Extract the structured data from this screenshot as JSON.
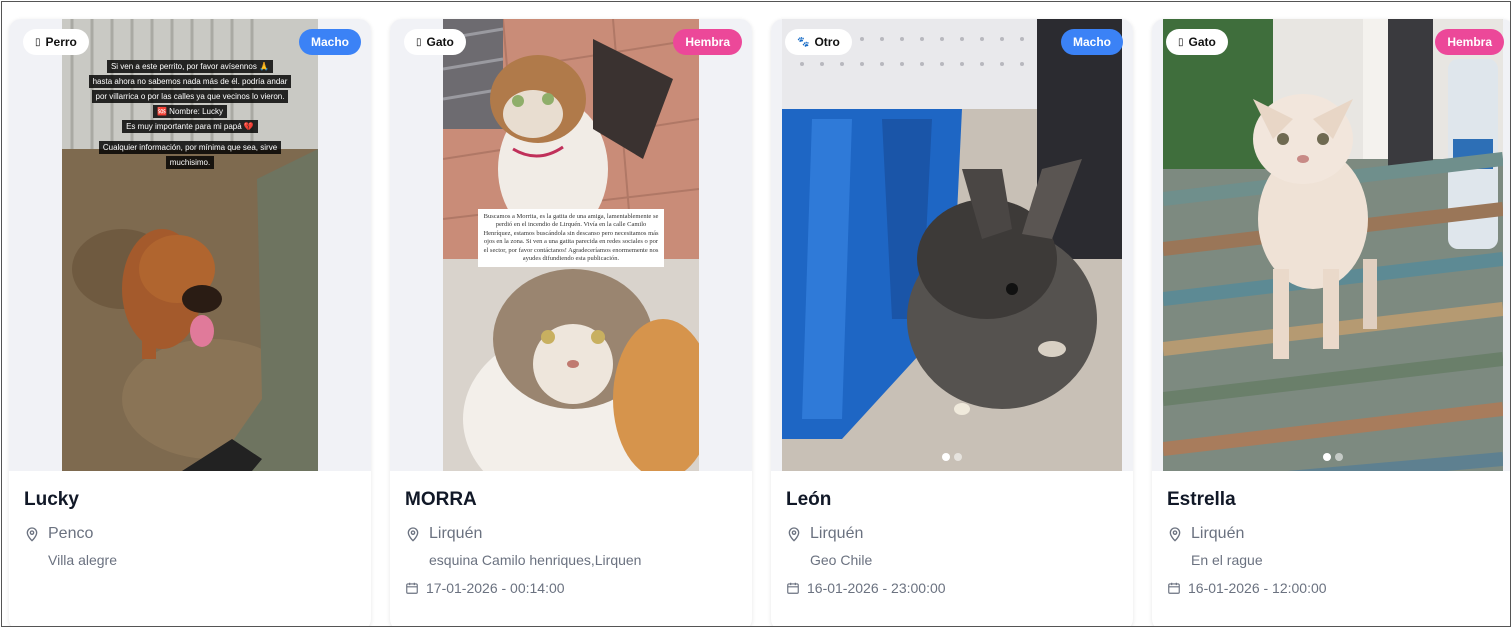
{
  "cards": [
    {
      "name": "Lucky",
      "type_icon": "phone-glyph",
      "type": "Perro",
      "sex": "Macho",
      "location": "Penco",
      "detail": "Villa alegre",
      "date": "",
      "image_text": [
        "Si ven a este perrito, por favor avísennos 🙏",
        "hasta ahora no sabemos nada más de él. podría andar",
        "por villarrica o por las calles ya que vecinos lo vieron.",
        "🆘 Nombre: Lucky",
        "Es muy importante para mi papá 💔",
        "Cualquier información, por mínima que sea, sirve",
        "muchisimo."
      ]
    },
    {
      "name": "MORRA",
      "type_icon": "phone-glyph",
      "type": "Gato",
      "sex": "Hembra",
      "location": "Lirquén",
      "detail": "esquina Camilo henriques,Lirquen",
      "date": "17-01-2026 - 00:14:00",
      "image_text": [
        "Buscamos a Morrita, es la gatita de una amiga, lamentablemente se perdió en el incendio de Lirquén. Vivía en la calle Camilo Henríquez, estamos buscándola sin descanso pero necesitamos más ojos en la zona. Si ven a una gatita parecida en redes sociales o por el sector, por favor contáctanos! Agradeceríamos enormemente nos ayudes difundiendo esta publicación."
      ]
    },
    {
      "name": "León",
      "type_icon": "paw-glyph",
      "type": "Otro",
      "sex": "Macho",
      "location": "Lirquén",
      "detail": "Geo Chile",
      "date": "16-01-2026 - 23:00:00",
      "image_text": []
    },
    {
      "name": "Estrella",
      "type_icon": "phone-glyph",
      "type": "Gato",
      "sex": "Hembra",
      "location": "Lirquén",
      "detail": "En el rague",
      "date": "16-01-2026 - 12:00:00",
      "image_text": []
    }
  ],
  "colors": {
    "male": "#3b82f6",
    "female": "#ec4899",
    "muted_text": "#6b7280"
  },
  "icons": {
    "location": "map-pin-icon",
    "date": "calendar-icon"
  }
}
